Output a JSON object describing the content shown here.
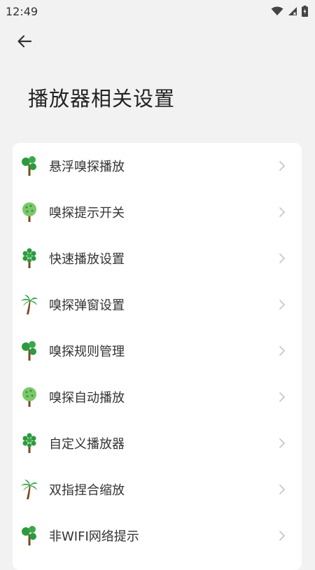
{
  "status_bar": {
    "time": "12:49"
  },
  "header": {
    "title": "播放器相关设置"
  },
  "colors": {
    "background": "#f2f2f2",
    "card": "#ffffff",
    "tree_green": "#2e9a3e",
    "tree_light": "#7cc86a",
    "trunk": "#7a4a1c"
  },
  "menu": {
    "items": [
      {
        "label": "悬浮嗅探播放",
        "icon": "tree-a-icon"
      },
      {
        "label": "嗅探提示开关",
        "icon": "tree-b-icon"
      },
      {
        "label": "快速播放设置",
        "icon": "tree-c-icon"
      },
      {
        "label": "嗅探弹窗设置",
        "icon": "palm-icon"
      },
      {
        "label": "嗅探规则管理",
        "icon": "tree-a-icon"
      },
      {
        "label": "嗅探自动播放",
        "icon": "tree-b-icon"
      },
      {
        "label": "自定义播放器",
        "icon": "tree-c-icon"
      },
      {
        "label": "双指捏合缩放",
        "icon": "palm-icon"
      },
      {
        "label": "非WIFI网络提示",
        "icon": "tree-a-icon"
      }
    ]
  }
}
